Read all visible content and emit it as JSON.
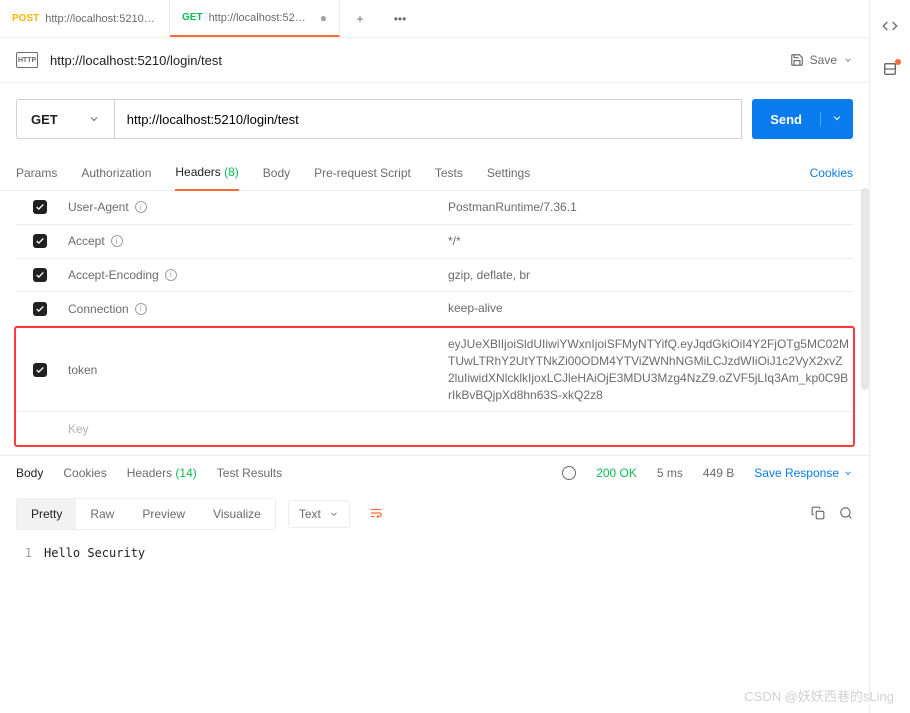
{
  "tabs": [
    {
      "method": "POST",
      "label": "http://localhost:5210/lo...",
      "active": false
    },
    {
      "method": "GET",
      "label": "http://localhost:5210/logi...",
      "active": true
    }
  ],
  "titlebar": {
    "title": "http://localhost:5210/login/test",
    "save_label": "Save"
  },
  "request": {
    "method": "GET",
    "url": "http://localhost:5210/login/test",
    "send_label": "Send"
  },
  "request_tabs": {
    "params": "Params",
    "authorization": "Authorization",
    "headers": "Headers",
    "headers_count": "(8)",
    "body": "Body",
    "pre_request": "Pre-request Script",
    "tests": "Tests",
    "settings": "Settings",
    "cookies": "Cookies"
  },
  "headers": [
    {
      "checked": true,
      "key": "User-Agent",
      "info": true,
      "value": "PostmanRuntime/7.36.1"
    },
    {
      "checked": true,
      "key": "Accept",
      "info": true,
      "value": "*/*"
    },
    {
      "checked": true,
      "key": "Accept-Encoding",
      "info": true,
      "value": "gzip, deflate, br"
    },
    {
      "checked": true,
      "key": "Connection",
      "info": true,
      "value": "keep-alive"
    }
  ],
  "highlighted_headers": [
    {
      "checked": true,
      "key": "token",
      "info": false,
      "value": "eyJUeXBlIjoiSldUIiwiYWxnIjoiSFMyNTYifQ.eyJqdGkiOiI4Y2FjOTg5MC02MTUwLTRhY2UtYTNkZi00ODM4YTViZWNhNGMiLCJzdWIiOiJ1c2VyX2xvZ2luIiwidXNlcklkIjoxLCJleHAiOjE3MDU3Mzg4NzZ9.oZVF5jLIq3Am_kp0C9BrIkBvBQjpXd8hn63S-xkQ2z8"
    },
    {
      "placeholder": true,
      "key": "Key",
      "value": ""
    }
  ],
  "response_tabs": {
    "body": "Body",
    "cookies": "Cookies",
    "headers": "Headers",
    "headers_count": "(14)",
    "test_results": "Test Results"
  },
  "response_status": {
    "status": "200 OK",
    "time": "5 ms",
    "size": "449 B",
    "save_label": "Save Response"
  },
  "response_toolbar": {
    "pretty": "Pretty",
    "raw": "Raw",
    "preview": "Preview",
    "visualize": "Visualize",
    "type": "Text"
  },
  "response_body": {
    "line_no": "1",
    "content": "Hello Security"
  },
  "watermark": "CSDN @妖妖西巷的sLing"
}
